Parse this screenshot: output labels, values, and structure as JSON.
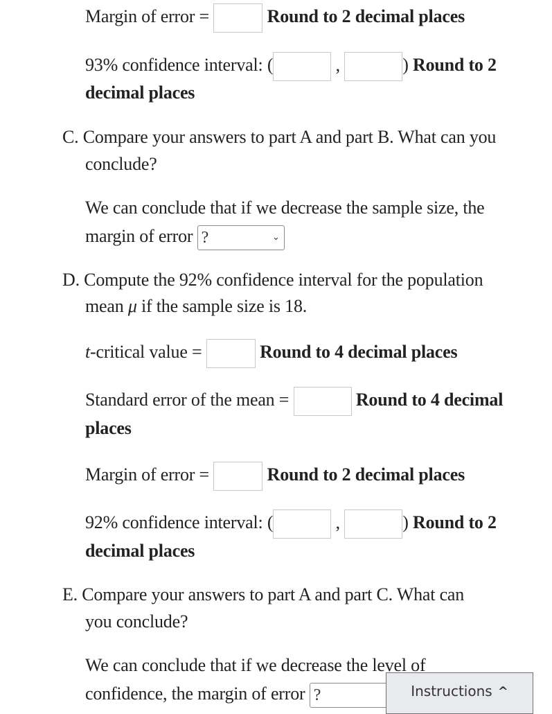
{
  "part_b_tail": {
    "margin_label": "Margin of error =",
    "margin_hint": "Round to 2 decimal places",
    "ci_label": "93% confidence interval: (",
    "ci_comma": ",",
    "ci_close": ")",
    "ci_hint_1": "Round to 2",
    "ci_hint_2": "decimal places"
  },
  "part_c": {
    "question_1": "C. Compare your answers to part A and part B. What can you",
    "question_2": "conclude?",
    "conclusion_1": "We can conclude that if we decrease the sample size, the",
    "conclusion_2": "margin of error",
    "select_value": "?"
  },
  "part_d": {
    "question_1_a": "D. Compute the ",
    "question_1_b": "92%",
    "question_1_c": " confidence interval for the population",
    "question_2_a": "mean ",
    "question_2_mu": "μ",
    "question_2_b": " if the sample size is ",
    "question_2_n": "18",
    "question_2_end": ".",
    "t_label_italic": "t",
    "t_label": "-critical value =",
    "t_hint": "Round to 4 decimal places",
    "se_label": "Standard error of the mean =",
    "se_hint_1": "Round to 4 decimal",
    "se_hint_2": "places",
    "margin_label": "Margin of error =",
    "margin_hint": "Round to 2 decimal places",
    "ci_label": "92% confidence interval: (",
    "ci_comma": ",",
    "ci_close": ")",
    "ci_hint_1": "Round to 2",
    "ci_hint_2": "decimal places"
  },
  "part_e": {
    "question_1": "E. Compare your answers to part A and part C. What can",
    "question_2": "you conclude?",
    "conclusion_1": "We can conclude that if we decrease the level of",
    "conclusion_2": "confidence, the margin of error",
    "select_value": "?"
  },
  "instructions_button": {
    "label": "Instructions",
    "icon": "chevron-up-icon"
  }
}
